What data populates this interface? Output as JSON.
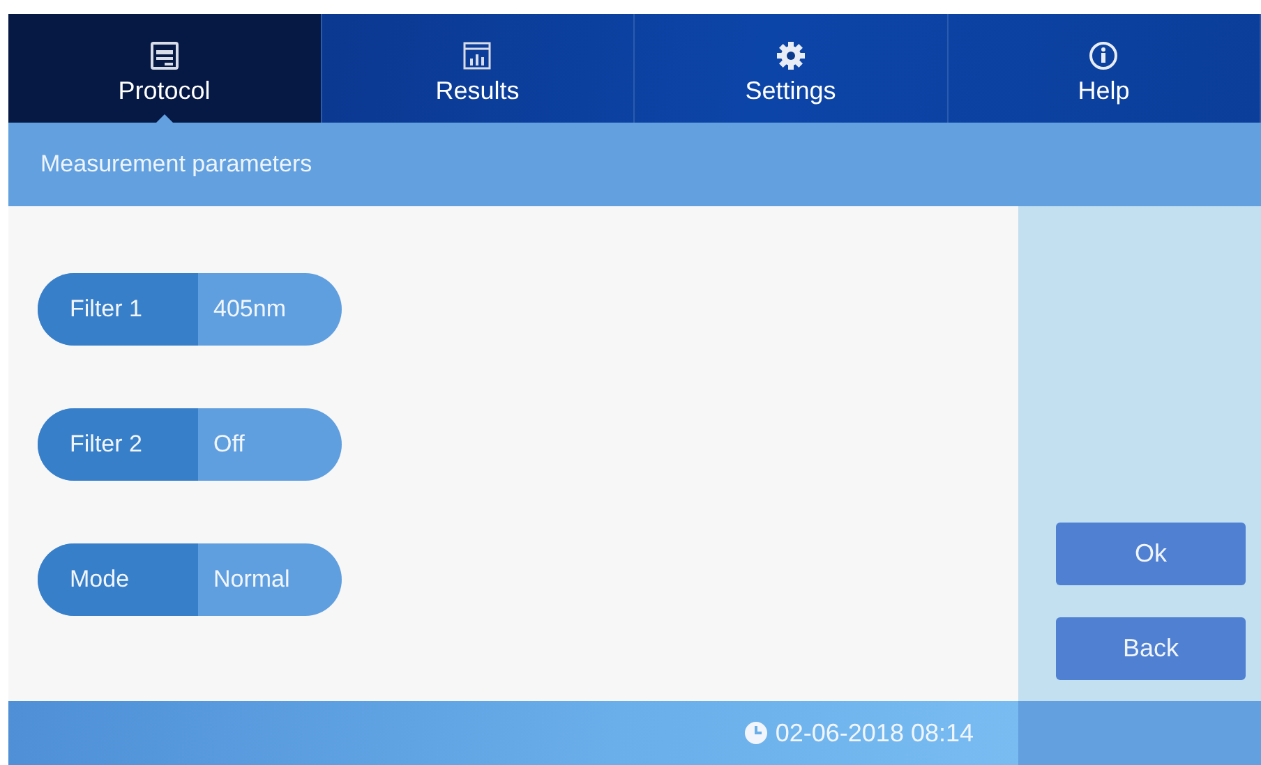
{
  "tabs": [
    {
      "label": "Protocol",
      "kind": "window",
      "selected": true
    },
    {
      "label": "Results",
      "kind": "chart",
      "selected": false
    },
    {
      "label": "Settings",
      "kind": "gear",
      "selected": false
    },
    {
      "label": "Help",
      "kind": "info",
      "selected": false
    }
  ],
  "header": {
    "title": "Measurement parameters"
  },
  "parameters": [
    {
      "label": "Filter 1",
      "value": "405nm"
    },
    {
      "label": "Filter 2",
      "value": "Off"
    },
    {
      "label": "Mode",
      "value": "Normal"
    }
  ],
  "buttons": [
    "Ok",
    "Back"
  ],
  "status_bar": {
    "datetime": "02-06-2018 08:14"
  }
}
